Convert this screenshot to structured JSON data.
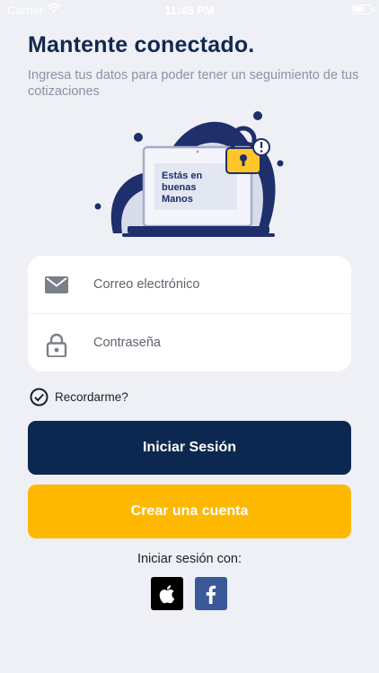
{
  "status_bar": {
    "carrier": "Carrier",
    "time": "11:45 PM"
  },
  "header": {
    "title": "Mantente conectado.",
    "subtitle": "Ingresa tus datos para poder tener un seguimiento de tus cotizaciones"
  },
  "illustration": {
    "screen_text": [
      "Estás en",
      "buenas",
      "Manos"
    ]
  },
  "form": {
    "email_placeholder": "Correo electrónico",
    "password_placeholder": "Contraseña",
    "remember_label": "Recordarme?"
  },
  "buttons": {
    "login": "Iniciar Sesión",
    "signup": "Crear una cuenta"
  },
  "social": {
    "label": "Iniciar sesión con:",
    "providers": [
      "apple",
      "facebook"
    ]
  },
  "colors": {
    "primary": "#0d2850",
    "accent": "#ffb800",
    "background": "#eef0f5",
    "facebook": "#3b5998"
  }
}
